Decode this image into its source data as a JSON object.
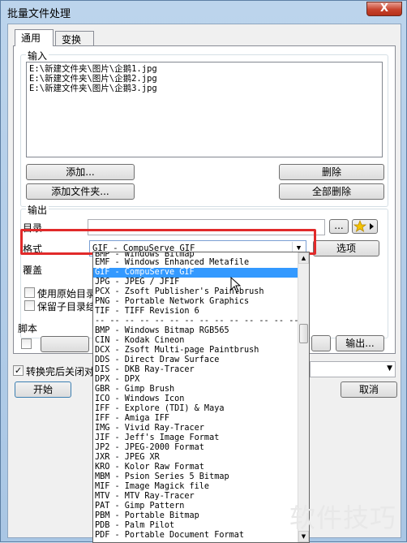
{
  "window": {
    "title": "批量文件处理",
    "close_label": "X"
  },
  "tabs": [
    {
      "label": "通用"
    },
    {
      "label": "变换"
    }
  ],
  "input": {
    "group_label": "输入",
    "files": [
      "E:\\新建文件夹\\图片\\企鹅1.jpg",
      "E:\\新建文件夹\\图片\\企鹅2.jpg",
      "E:\\新建文件夹\\图片\\企鹅3.jpg"
    ],
    "add_label": "添加...",
    "add_folder_label": "添加文件夹...",
    "delete_label": "删除",
    "delete_all_label": "全部删除"
  },
  "output": {
    "group_label": "输出",
    "dir_label": "目录",
    "browse_label": "...",
    "format_label": "格式",
    "format_value": "GIF - CompuServe GIF",
    "options_label": "选项",
    "overwrite_label": "覆盖",
    "use_original_label": "使用原始目录",
    "keep_subdir_label": "保留子目录结构"
  },
  "script": {
    "group_label": "脚本",
    "output_label": "输出..."
  },
  "close_after_label": "转换完后关闭对话框",
  "start_label": "开始",
  "cancel_label": "取消",
  "dropdown_items": [
    "BMP - Windows Bitmap",
    "EMF - Windows Enhanced Metafile",
    "GIF - CompuServe GIF",
    "JPG - JPEG / JFIF",
    "PCX - Zsoft Publisher's Paintbrush",
    "PNG - Portable Network Graphics",
    "TIF - TIFF Revision 6",
    "-- -- -- -- -- -- -- -- -- -- -- -- -- --",
    "BMP - Windows Bitmap RGB565",
    "CIN - Kodak Cineon",
    "DCX - Zsoft Multi-page Paintbrush",
    "DDS - Direct Draw Surface",
    "DIS - DKB Ray-Tracer",
    "DPX - DPX",
    "GBR - Gimp Brush",
    "ICO - Windows Icon",
    "IFF - Explore (TDI) & Maya",
    "IFF - Amiga IFF",
    "IMG - Vivid Ray-Tracer",
    "JIF - Jeff's Image Format",
    "JP2 - JPEG-2000 Format",
    "JXR - JPEG XR",
    "KRO - Kolor Raw Format",
    "MBM - Psion Series 5 Bitmap",
    "MIF - Image Magick file",
    "MTV - MTV Ray-Tracer",
    "PAT - Gimp Pattern",
    "PBM - Portable Bitmap",
    "PDB - Palm Pilot",
    "PDF - Portable Document Format"
  ],
  "selected_index": 2,
  "watermark": "软件技巧",
  "colors": {
    "highlight": "#3399ff",
    "red_box": "#e12a2a"
  }
}
